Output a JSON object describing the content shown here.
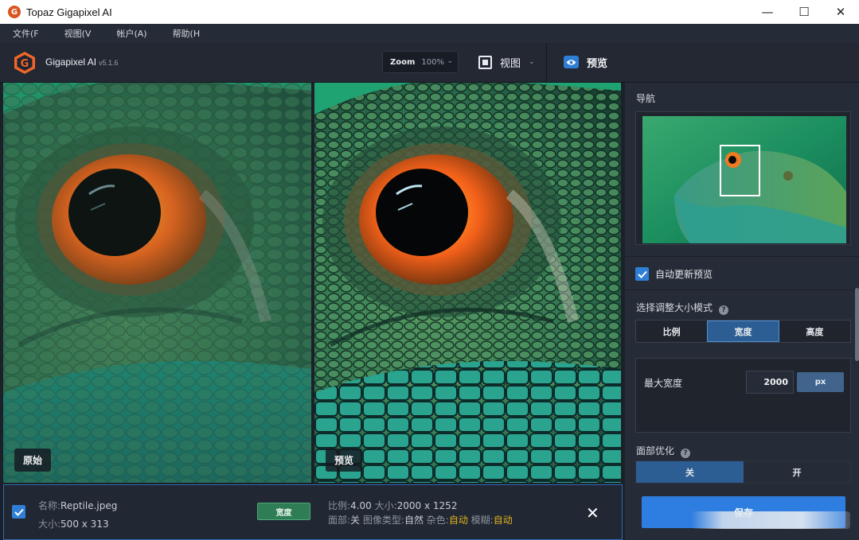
{
  "window": {
    "title": "Topaz Gigapixel AI",
    "controls": {
      "minimize": "—",
      "maximize": "☐",
      "close": "✕"
    }
  },
  "menu": {
    "items": [
      "文件(F",
      "视图(V",
      "帐户(A)",
      "帮助(H"
    ]
  },
  "header": {
    "brand_name": "Gigapixel AI",
    "version": "v5.1.6",
    "zoom_label": "Zoom",
    "zoom_value": "100%",
    "view_label": "视图",
    "preview_label": "预览"
  },
  "panes": {
    "original_label": "原始",
    "preview_label": "预览"
  },
  "panel": {
    "navigator_title": "导航",
    "auto_update_label": "自动更新预览",
    "auto_update_checked": true,
    "resize_mode_title": "选择调整大小模式",
    "resize_modes": [
      "比例",
      "宽度",
      "高度"
    ],
    "resize_mode_selected": "宽度",
    "max_width_label": "最大宽度",
    "max_width_value": "2000",
    "unit": "px",
    "face_refine_title": "面部优化",
    "face_options": [
      "关",
      "开"
    ],
    "face_selected": "关",
    "save_label": "保存"
  },
  "file": {
    "checked": true,
    "name_key": "名称:",
    "name": "Reptile.jpeg",
    "size_key": "大小:",
    "size": "500 x 313",
    "mode_badge": "宽度",
    "scale_key": "比例:",
    "scale": "4.00",
    "out_size_key": "大小:",
    "out_size": "2000 x 1252",
    "face_key": "面部:",
    "face": "关",
    "type_key": "图像类型:",
    "type": "自然",
    "noise_key": "杂色:",
    "noise": "自动",
    "blur_key": "模糊:",
    "blur": "自动"
  },
  "colors": {
    "accent_blue": "#2e7de0",
    "badge_green": "#2e7d54",
    "auto_yellow": "#e3b31d"
  },
  "icons": [
    "topaz-logo-icon",
    "eye-icon",
    "view-split-icon",
    "checkbox-icon",
    "help-icon",
    "close-icon",
    "chevron-down-icon"
  ]
}
